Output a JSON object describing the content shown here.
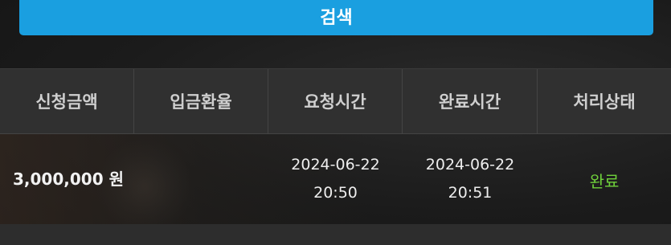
{
  "search": {
    "button_label": "검색"
  },
  "table": {
    "headers": [
      "신청금액",
      "입금환율",
      "요청시간",
      "완료시간",
      "처리상태"
    ],
    "rows": [
      {
        "amount": "3,000,000 원",
        "exchange_rate": "",
        "request_date": "2024-06-22",
        "request_time": "20:50",
        "complete_date": "2024-06-22",
        "complete_time": "20:51",
        "status": "완료"
      }
    ]
  },
  "colors": {
    "accent": "#1a9fe0",
    "status_complete": "#6fd13b",
    "header_bg": "#303030"
  }
}
